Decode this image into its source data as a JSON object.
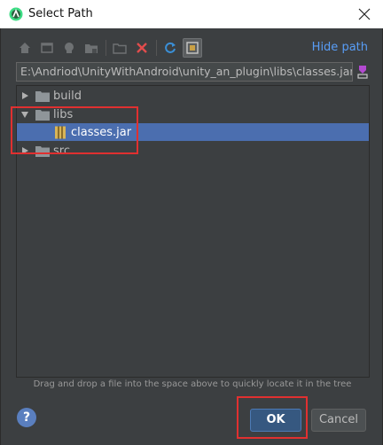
{
  "window": {
    "title": "Select Path",
    "close_glyph": "✕"
  },
  "toolbar": {
    "buttons": [
      "home-icon",
      "desktop-icon",
      "project-icon",
      "module-icon",
      "new-folder-icon",
      "delete-icon",
      "refresh-icon",
      "show-hidden-icon"
    ],
    "hide_path_label": "Hide path"
  },
  "path_field": {
    "value": "E:\\Andriod\\UnityWithAndroid\\unity_an_plugin\\libs\\classes.jar"
  },
  "tree": {
    "items": [
      {
        "label": "build",
        "expanded": false
      },
      {
        "label": "libs",
        "expanded": true
      },
      {
        "label": "classes.jar",
        "selected": true
      },
      {
        "label": "src",
        "expanded": false
      }
    ]
  },
  "hint": "Drag and drop a file into the space above to quickly locate it in the tree",
  "buttons": {
    "help": "?",
    "ok": "OK",
    "cancel": "Cancel"
  },
  "colors": {
    "accent": "#589df6",
    "selection": "#4b6eaf",
    "annotation": "#e03030",
    "background": "#3c3f41"
  }
}
